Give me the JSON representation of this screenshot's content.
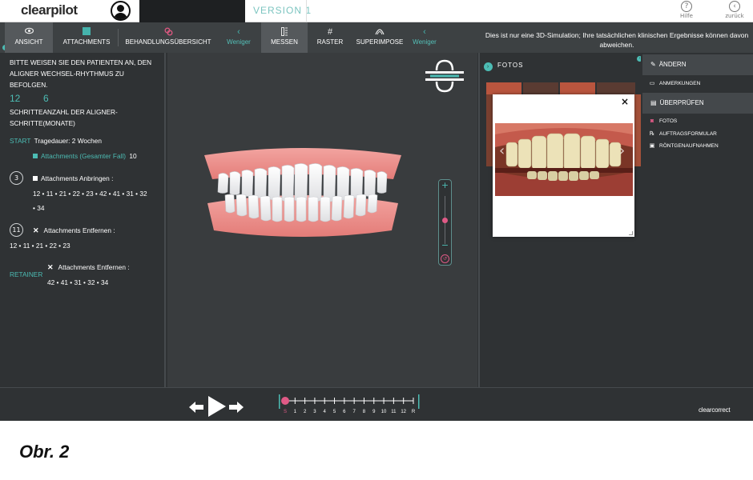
{
  "app": {
    "logo": "clearpilot",
    "version": "VERSION 1",
    "help_label": "Hilfe",
    "back_label": "zurück",
    "help_icon": "question-icon",
    "back_icon": "back-arrow-icon"
  },
  "toolbar": {
    "items": [
      {
        "label": "ANSICHT",
        "icon": "eye-icon"
      },
      {
        "label": "ATTACHMENTS",
        "icon": "square-icon"
      },
      {
        "label": "BEHANDLUNGSÜBERSICHT",
        "icon": "link-icon"
      },
      {
        "label": "Weniger",
        "icon": "chevron-left-icon"
      },
      {
        "label": "MESSEN",
        "icon": "ruler-icon"
      },
      {
        "label": "RASTER",
        "icon": "grid-icon"
      },
      {
        "label": "SUPERIMPOSE",
        "icon": "superimpose-icon"
      },
      {
        "label": "Weniger",
        "icon": "chevron-left-icon"
      }
    ],
    "notice": "Dies ist nur eine 3D-Simulation; Ihre tatsächlichen klinischen Ergebnisse können davon abweichen."
  },
  "left_panel": {
    "instruction": "BITTE WEISEN SIE DEN PATIENTEN AN, DEN ALIGNER WECHSEL-RHYTHMUS ZU BEFOLGEN.",
    "steps_count": "12",
    "months_count": "6",
    "steps_label": "SCHRITTEANZAHL DER ALIGNER-SCHRITTE(MONATE)",
    "start_label": "START",
    "wear_time": "Tragedauer: 2 Wochen",
    "attachments_total_label": "Attachments (Gesamter Fall)",
    "attachments_total_value": "10",
    "apply_step": "3",
    "apply_label": "Attachments Anbringen :",
    "apply_teeth_line1": "12 • 11 • 21 • 22 • 23 • 42 • 41 • 31 • 32",
    "apply_teeth_line2": "• 34",
    "remove_step": "11",
    "remove_label": "Attachments Entfernen :",
    "remove_teeth": "12 • 11 • 21 • 22 • 23",
    "retainer_label": "RETAINER",
    "retainer_remove_label": "Attachments Entfernen :",
    "retainer_teeth": "42 • 41 • 31 • 32 • 34"
  },
  "viewer": {
    "zoom_plus": "+",
    "zoom_minus": "−",
    "zoom_level": 0.5
  },
  "photos": {
    "title": "FOTOS",
    "close": "×"
  },
  "right_panel": {
    "sections": [
      {
        "label": "ÄNDERN",
        "icon": "pencil-icon"
      },
      {
        "label": "ÜBERPRÜFEN",
        "icon": "document-icon"
      }
    ],
    "aendern_items": [
      {
        "label": "ANMERKUNGEN",
        "icon": "comment-icon"
      }
    ],
    "pruefen_items": [
      {
        "label": "FOTOS",
        "icon": "camera-icon"
      },
      {
        "label": "AUFTRAGSFORMULAR",
        "icon": "rx-icon"
      },
      {
        "label": "RÖNTGENAUFNAHMEN",
        "icon": "xray-icon"
      }
    ]
  },
  "playback": {
    "timeline_labels": [
      "S",
      "1",
      "2",
      "3",
      "4",
      "5",
      "6",
      "7",
      "8",
      "9",
      "10",
      "11",
      "12",
      "R"
    ],
    "current_step": 0,
    "brand": "clearcorrect"
  },
  "caption": "Obr. 2",
  "colors": {
    "accent": "#4cbcb4",
    "pink": "#e05a86",
    "panel_bg": "#2f3234",
    "toolbar_bg": "#3d4143"
  }
}
